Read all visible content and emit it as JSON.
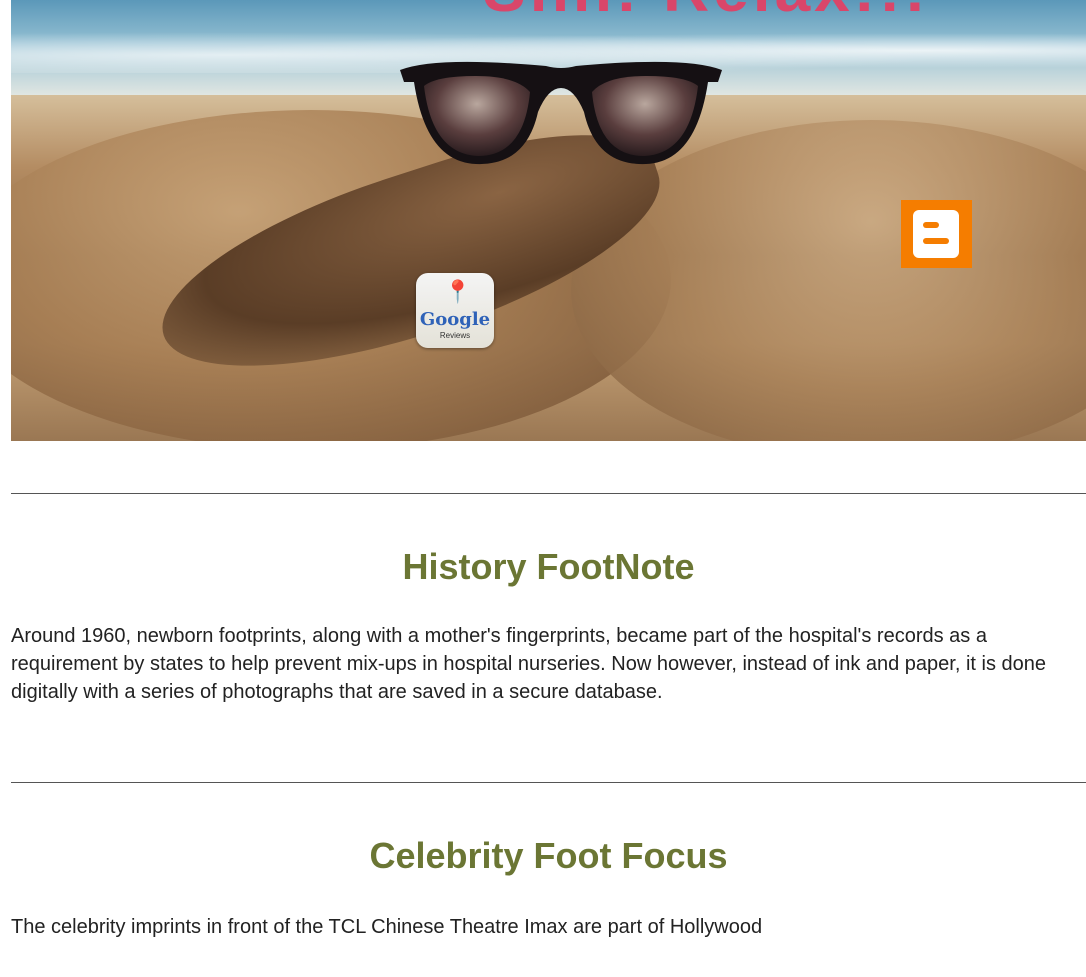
{
  "hero": {
    "headline": "Shh! Relax!!!",
    "badges": {
      "google": {
        "word": "Google",
        "sub": "Reviews",
        "icon": "map-pin-icon"
      },
      "blogger": {
        "icon": "blogger-icon",
        "color": "#f57d00"
      }
    }
  },
  "sections": [
    {
      "title": "History FootNote",
      "body": "Around 1960, newborn footprints, along with a mother's fingerprints, became part of the hospital's records as a requirement by states to help prevent mix-ups in hospital nurseries. Now however, instead of ink and paper, it is done digitally with a series of photographs that are saved in a secure database."
    },
    {
      "title": "Celebrity Foot Focus",
      "body": "The celebrity imprints in front of the TCL Chinese Theatre Imax are part of Hollywood"
    }
  ],
  "colors": {
    "heading": "#6b7634",
    "text": "#222222"
  }
}
